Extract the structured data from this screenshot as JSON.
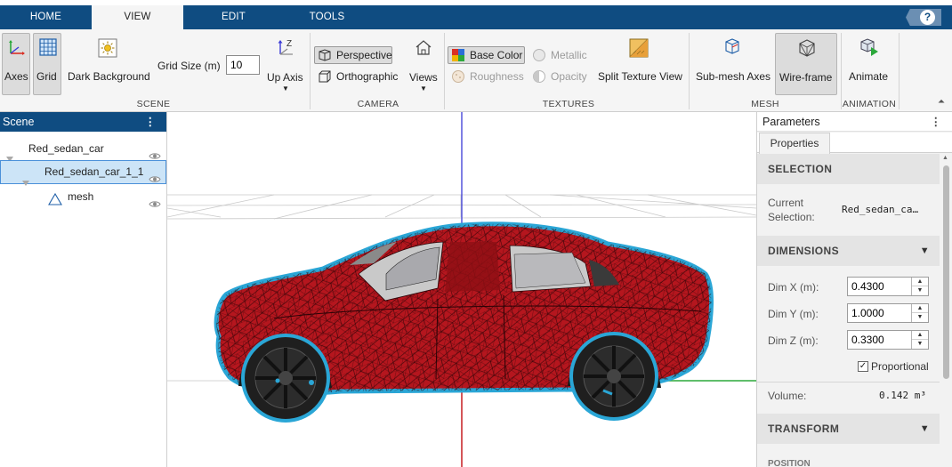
{
  "tabs": [
    {
      "label": "HOME",
      "active": false
    },
    {
      "label": "VIEW",
      "active": true
    },
    {
      "label": "EDIT",
      "active": false
    },
    {
      "label": "TOOLS",
      "active": false
    }
  ],
  "help_icon": "question-mark-icon",
  "ribbon": {
    "scene": {
      "section_label": "SCENE",
      "axes_label": "Axes",
      "grid_label": "Grid",
      "dark_background_label": "Dark Background",
      "grid_size_label": "Grid Size (m)",
      "grid_size_value": "10",
      "up_axis_label": "Up Axis"
    },
    "camera": {
      "section_label": "CAMERA",
      "perspective_label": "Perspective",
      "orthographic_label": "Orthographic",
      "views_label": "Views"
    },
    "textures": {
      "section_label": "TEXTURES",
      "base_color_label": "Base Color",
      "metallic_label": "Metallic",
      "roughness_label": "Roughness",
      "opacity_label": "Opacity",
      "split_texture_label": "Split Texture View"
    },
    "mesh": {
      "section_label": "MESH",
      "sub_mesh_axes_label": "Sub-mesh Axes",
      "wireframe_label": "Wire-frame"
    },
    "animation": {
      "section_label": "ANIMATION",
      "animate_label": "Animate"
    }
  },
  "scene_panel": {
    "title": "Scene",
    "items": [
      {
        "label": "Red_sedan_car",
        "level": 0,
        "selected": false
      },
      {
        "label": "Red_sedan_car_1_1",
        "level": 1,
        "selected": true
      },
      {
        "label": "mesh",
        "level": 2,
        "selected": false
      }
    ]
  },
  "viewport": {
    "car_body_color": "#b5161e",
    "outline_color": "#2aa6d6",
    "axis_colors": {
      "x": "#d93025",
      "y": "#2ba83a",
      "z": "#3a3ad6"
    }
  },
  "params": {
    "title": "Parameters",
    "tab_label": "Properties",
    "selection": {
      "header": "SELECTION",
      "current_label_1": "Current",
      "current_label_2": "Selection:",
      "current_value": "Red_sedan_ca…"
    },
    "dimensions": {
      "header": "DIMENSIONS",
      "dim_x_label": "Dim X (m):",
      "dim_x_value": "0.4300",
      "dim_y_label": "Dim Y (m):",
      "dim_y_value": "1.0000",
      "dim_z_label": "Dim Z (m):",
      "dim_z_value": "0.3300",
      "proportional_label": "Proportional",
      "proportional_checked": true,
      "volume_label": "Volume:",
      "volume_value": "0.142 m³"
    },
    "transform": {
      "header": "TRANSFORM",
      "next_label": "POSITION"
    }
  }
}
